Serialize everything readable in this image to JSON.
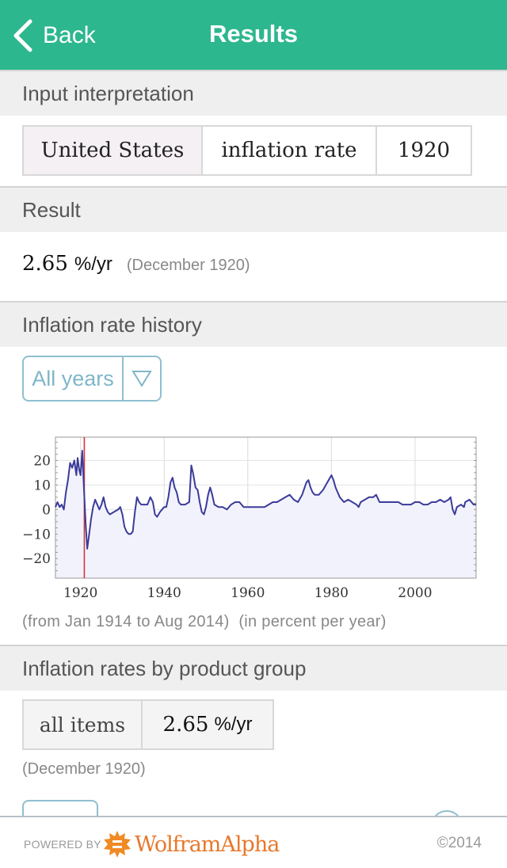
{
  "nav": {
    "back_label": "Back",
    "title": "Results",
    "color": "#2db78e"
  },
  "sections": {
    "input_interpretation": {
      "title": "Input interpretation",
      "cells": [
        "United States",
        "inflation rate",
        "1920"
      ]
    },
    "result": {
      "title": "Result",
      "value": "2.65",
      "unit": "%/yr",
      "note": "(December 1920)"
    },
    "history": {
      "title": "Inflation rate history",
      "dropdown_value": "All years",
      "note_range": "(from Jan 1914 to Aug 2014)",
      "note_units": "(in percent per year)"
    },
    "product_group": {
      "title": "Inflation rates by product group",
      "row_label": "all items",
      "row_value": "2.65",
      "row_unit": "%/yr",
      "note": "(December 1920)"
    }
  },
  "footer": {
    "powered_by": "POWERED BY",
    "brand": "WolframAlpha",
    "copyright": "©2014"
  },
  "chart_data": {
    "type": "line",
    "title": "Inflation rate history",
    "xlabel": "",
    "ylabel": "percent per year",
    "xlim": [
      1914,
      2014.6
    ],
    "ylim": [
      -28,
      29.5
    ],
    "xticks": [
      1920,
      1940,
      1960,
      1980,
      2000
    ],
    "yticks": [
      20,
      10,
      0,
      -10,
      -20
    ],
    "grid": true,
    "marker_year": 1920.9,
    "marker_color": "#d0383c",
    "line_color": "#3b3b9a",
    "fill_color": "#f2f2fc",
    "series": [
      {
        "name": "US inflation rate",
        "x": [
          1914,
          1914.5,
          1915,
          1915.5,
          1916,
          1916.5,
          1917,
          1917.5,
          1918,
          1918.5,
          1919,
          1919.3,
          1919.7,
          1920,
          1920.4,
          1920.8,
          1921.2,
          1921.6,
          1922,
          1922.5,
          1923,
          1923.5,
          1924,
          1924.5,
          1925,
          1925.5,
          1926,
          1926.5,
          1927,
          1928,
          1929,
          1929.5,
          1930,
          1930.5,
          1931,
          1931.5,
          1932,
          1932.5,
          1933,
          1933.5,
          1934,
          1934.5,
          1935,
          1936,
          1936.7,
          1937.3,
          1937.8,
          1938.3,
          1939,
          1940,
          1940.5,
          1941,
          1941.5,
          1942,
          1942.5,
          1943,
          1943.5,
          1944,
          1945,
          1946,
          1946.5,
          1947,
          1947.5,
          1948,
          1948.5,
          1949,
          1949.5,
          1950,
          1950.5,
          1951,
          1951.5,
          1952,
          1953,
          1954,
          1955,
          1956,
          1957,
          1958,
          1959,
          1960,
          1961,
          1962,
          1963,
          1964,
          1965,
          1966,
          1967,
          1968,
          1969,
          1970,
          1971,
          1972,
          1973,
          1974,
          1974.5,
          1975,
          1975.5,
          1976,
          1977,
          1978,
          1979,
          1980,
          1980.5,
          1981,
          1982,
          1983,
          1984,
          1985,
          1986,
          1986.5,
          1987,
          1988,
          1989,
          1990,
          1990.7,
          1991.5,
          1992,
          1993,
          1994,
          1995,
          1996,
          1997,
          1998,
          1999,
          2000,
          2001,
          2002,
          2003,
          2004,
          2005,
          2006,
          2007,
          2008,
          2008.5,
          2009,
          2009.5,
          2010,
          2011,
          2011.7,
          2012,
          2013,
          2014,
          2014.6
        ],
        "values": [
          1,
          3,
          1,
          2,
          0,
          7,
          12,
          19,
          17,
          20,
          14,
          21,
          16,
          14,
          24,
          9,
          -5,
          -16,
          -11,
          -4,
          1,
          4,
          2,
          0,
          2,
          5,
          1,
          -1,
          -2,
          -1,
          0,
          1,
          -2,
          -7,
          -9,
          -10,
          -10,
          -9,
          -1,
          5,
          3,
          2,
          2,
          2,
          5,
          3,
          -2,
          -3,
          -1,
          1,
          1,
          5,
          11,
          13,
          9,
          7,
          3,
          2,
          2,
          3,
          18,
          14,
          9,
          8,
          3,
          -1,
          -2,
          1,
          6,
          9,
          6,
          2,
          1,
          1,
          0,
          2,
          3,
          3,
          1,
          1,
          1,
          1,
          1,
          1,
          2,
          3,
          3,
          4,
          5,
          6,
          4,
          3,
          6,
          11,
          12,
          9,
          7,
          6,
          6,
          8,
          11,
          14,
          12,
          9,
          5,
          3,
          4,
          3,
          2,
          1,
          3,
          4,
          5,
          5,
          6,
          3,
          3,
          3,
          3,
          3,
          3,
          2,
          2,
          2,
          3,
          3,
          2,
          2,
          3,
          3,
          4,
          3,
          4,
          5,
          0,
          -2,
          1,
          2,
          1,
          3,
          4,
          2,
          2,
          1,
          2
        ]
      }
    ]
  }
}
